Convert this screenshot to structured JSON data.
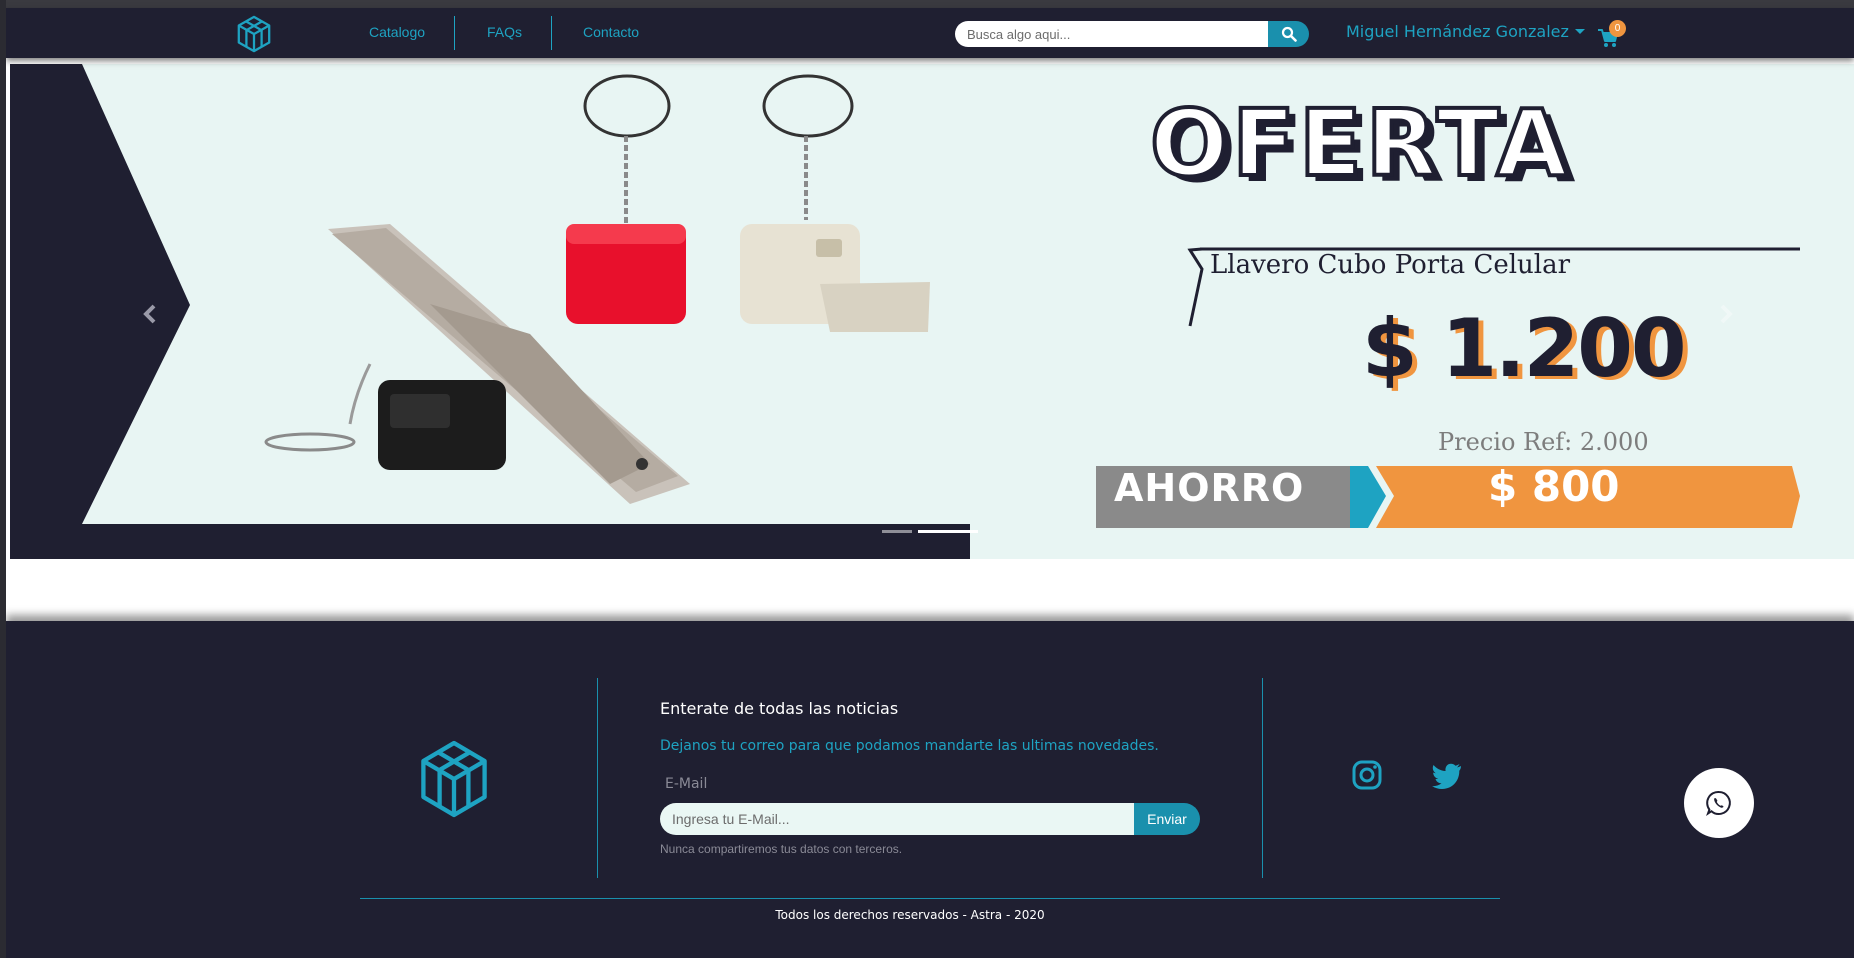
{
  "navbar": {
    "links": [
      {
        "label": "Catalogo"
      },
      {
        "label": "FAQs"
      },
      {
        "label": "Contacto"
      }
    ],
    "search": {
      "placeholder": "Busca algo aqui..."
    },
    "user": {
      "name": "Miguel Hernández Gonzalez"
    },
    "cart": {
      "count": "0"
    }
  },
  "banner": {
    "title": "OFERTA",
    "product": "Llavero Cubo Porta Celular",
    "price": "$ 1.200",
    "ref_price": "Precio Ref: 2.000",
    "savings_label": "AHORRO",
    "savings_value": "$ 800",
    "slide_count": 2,
    "active_slide": 2
  },
  "footer": {
    "newsletter_title": "Enterate de todas las noticias",
    "newsletter_sub": "Dejanos tu correo para que podamos mandarte las ultimas novedades.",
    "email_label": "E-Mail",
    "email_placeholder": "Ingresa tu E-Mail...",
    "submit_label": "Enviar",
    "privacy_note": "Nunca compartiremos tus datos con terceros.",
    "copyright": "Todos los derechos reservados - Astra - 2020",
    "social": [
      "instagram-icon",
      "twitter-icon"
    ]
  },
  "colors": {
    "navy": "#1f1f31",
    "accent": "#1ea3c2",
    "button": "#1a90ad",
    "orange": "#f0953f"
  }
}
